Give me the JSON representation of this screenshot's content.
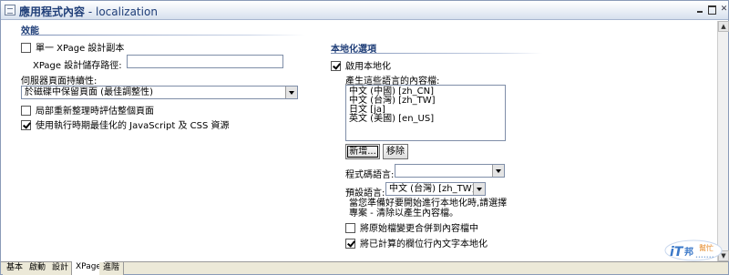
{
  "window": {
    "title": "應用程式內容",
    "title_sep": " - ",
    "subtitle": "localization"
  },
  "performance": {
    "header": "效能",
    "single_copy": {
      "label": "單一 XPage 設計副本",
      "checked": false
    },
    "storage_path": {
      "label": "XPage 設計儲存路徑:",
      "value": ""
    },
    "persistence": {
      "label": "伺服器頁面持續性:",
      "selected": "於磁碟中保留頁面 (最佳調整性)"
    },
    "partial_refresh": {
      "label": "局部重新整理時評估整個頁面",
      "checked": false
    },
    "runtime_optimize": {
      "label": "使用執行時期最佳化的 JavaScript 及 CSS 資源",
      "checked": true
    }
  },
  "localization": {
    "header": "本地化選項",
    "enable": {
      "label": "啟用本地化",
      "checked": true
    },
    "languages_label": "產生這些語言的內容檔:",
    "languages": [
      "中文 (中國) [zh_CN]",
      "中文 (台灣) [zh_TW]",
      "日文 [ja]",
      "英文 (美國) [en_US]"
    ],
    "add_button": "新增...",
    "remove_button": "移除",
    "source_language": {
      "label": "程式碼語言:",
      "selected": ""
    },
    "default_language": {
      "label": "預設語言:",
      "selected": "中文 (台灣) [zh_TW]"
    },
    "note_line1": "當您準備好要開始進行本地化時,請選擇",
    "note_line2": "專案 - 清除以產生內容檔。",
    "merge_changes": {
      "label": "將原始檔變更合併到內容檔中",
      "checked": false
    },
    "localize_computed": {
      "label": "將已計算的欄位行內文字本地化",
      "checked": true
    }
  },
  "tabs": [
    {
      "label": "基本",
      "active": false
    },
    {
      "label": "啟動",
      "active": false
    },
    {
      "label": "設計",
      "active": false
    },
    {
      "label": "XPage",
      "active": true
    },
    {
      "label": "進階",
      "active": false
    }
  ],
  "watermark": {
    "logo": "iT邦",
    "tagline": "幫忙"
  },
  "colors": {
    "header_text": "#1f3e78",
    "title_bar": "#e7edf5"
  }
}
